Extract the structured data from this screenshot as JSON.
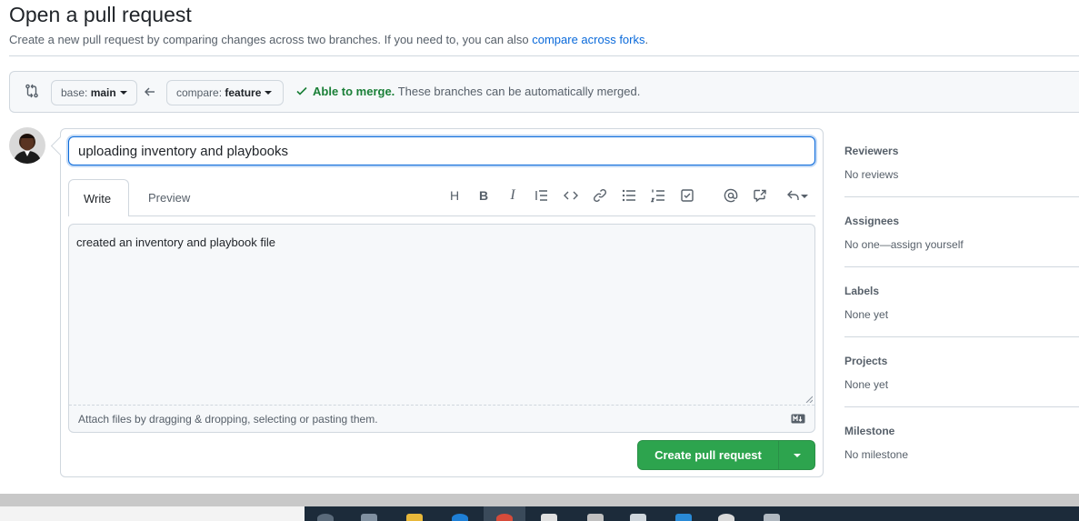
{
  "page": {
    "title": "Open a pull request",
    "subtitle_text": "Create a new pull request by comparing changes across two branches. If you need to, you can also",
    "subtitle_link": "compare across forks",
    "subtitle_end": "."
  },
  "range": {
    "base_prefix": "base:",
    "base_branch": "main",
    "compare_prefix": "compare:",
    "compare_branch": "feature",
    "merge_ok": "Able to merge.",
    "merge_msg": "These branches can be automatically merged."
  },
  "form": {
    "title_value": "uploading inventory and playbooks",
    "tabs": [
      "Write",
      "Preview"
    ],
    "body_text": "created an inventory and playbook file",
    "attach_text": "Attach files by dragging & dropping, selecting or pasting them.",
    "toolbar": {
      "heading": "H",
      "bold": "B",
      "italic": "I"
    },
    "submit_label": "Create pull request"
  },
  "sidebar": [
    {
      "heading": "Reviewers",
      "value": "No reviews"
    },
    {
      "heading": "Assignees",
      "value": "No one—assign yourself"
    },
    {
      "heading": "Labels",
      "value": "None yet"
    },
    {
      "heading": "Projects",
      "value": "None yet"
    },
    {
      "heading": "Milestone",
      "value": "No milestone"
    }
  ],
  "colors": {
    "accent": "#0969da",
    "success": "#1a7f37",
    "button_green": "#2da44e"
  },
  "icons": [
    "git-compare-icon",
    "arrow-left-icon",
    "check-icon",
    "heading-icon",
    "bold-icon",
    "italic-icon",
    "quote-icon",
    "code-icon",
    "link-icon",
    "unordered-list-icon",
    "ordered-list-icon",
    "task-list-icon",
    "mention-icon",
    "cross-reference-icon",
    "reply-icon",
    "markdown-icon"
  ]
}
